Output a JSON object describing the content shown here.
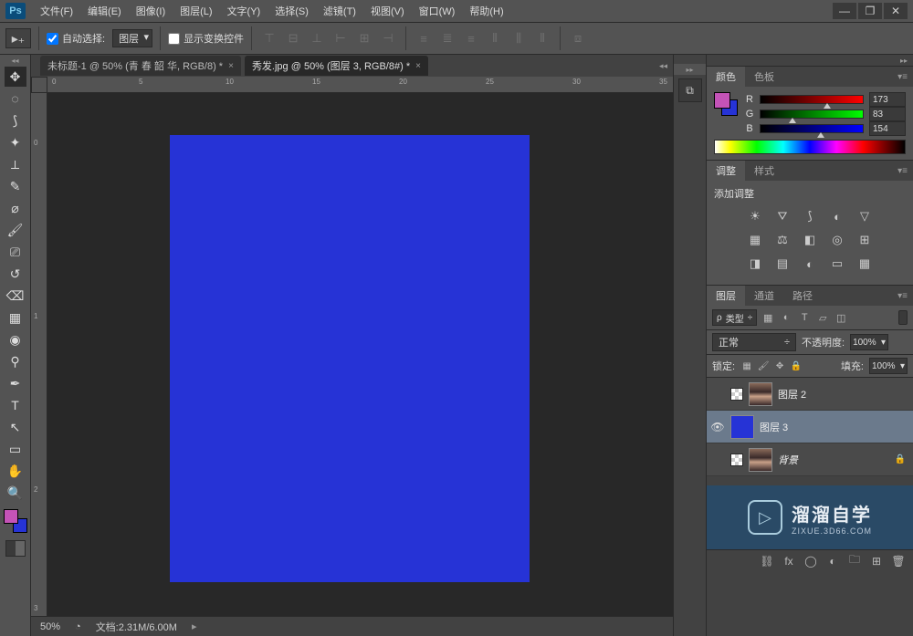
{
  "menu": {
    "items": [
      "文件(F)",
      "编辑(E)",
      "图像(I)",
      "图层(L)",
      "文字(Y)",
      "选择(S)",
      "滤镜(T)",
      "视图(V)",
      "窗口(W)",
      "帮助(H)"
    ]
  },
  "options": {
    "auto_select_label": "自动选择:",
    "auto_select_target": "图层",
    "show_transform_label": "显示变换控件"
  },
  "tabs": {
    "items": [
      {
        "title": "未标题-1 @ 50% (青 春 韶 华, RGB/8) *",
        "active": false
      },
      {
        "title": "秀发.jpg @ 50% (图层 3, RGB/8#) *",
        "active": true
      }
    ]
  },
  "rulers": {
    "h": [
      "0",
      "5",
      "10",
      "15",
      "20",
      "25",
      "30",
      "35"
    ],
    "v": [
      "0",
      "1",
      "2",
      "3"
    ]
  },
  "status": {
    "zoom": "50%",
    "doc_label": "文档:",
    "doc_size": "2.31M/6.00M"
  },
  "panels": {
    "color": {
      "tab": "颜色",
      "tab2": "色板",
      "r_label": "R",
      "g_label": "G",
      "b_label": "B",
      "r": "173",
      "g": "83",
      "b": "154"
    },
    "adjust": {
      "tab": "调整",
      "tab2": "样式",
      "title": "添加调整"
    },
    "layers": {
      "tab": "图层",
      "tab2": "通道",
      "tab3": "路径",
      "kind": "类型",
      "blend": "正常",
      "opacity_label": "不透明度:",
      "opacity": "100%",
      "lock_label": "锁定:",
      "fill_label": "填充:",
      "fill": "100%",
      "items": [
        {
          "name": "图层 2",
          "visible": false,
          "selected": false,
          "thumb": "portrait",
          "locked": false
        },
        {
          "name": "图层 3",
          "visible": true,
          "selected": true,
          "thumb": "blue",
          "locked": false
        },
        {
          "name": "背景",
          "visible": false,
          "selected": false,
          "thumb": "portrait",
          "locked": true,
          "italic": true
        }
      ]
    }
  },
  "watermark": {
    "big": "溜溜自学",
    "small": "ZIXUE.3D66.COM"
  }
}
